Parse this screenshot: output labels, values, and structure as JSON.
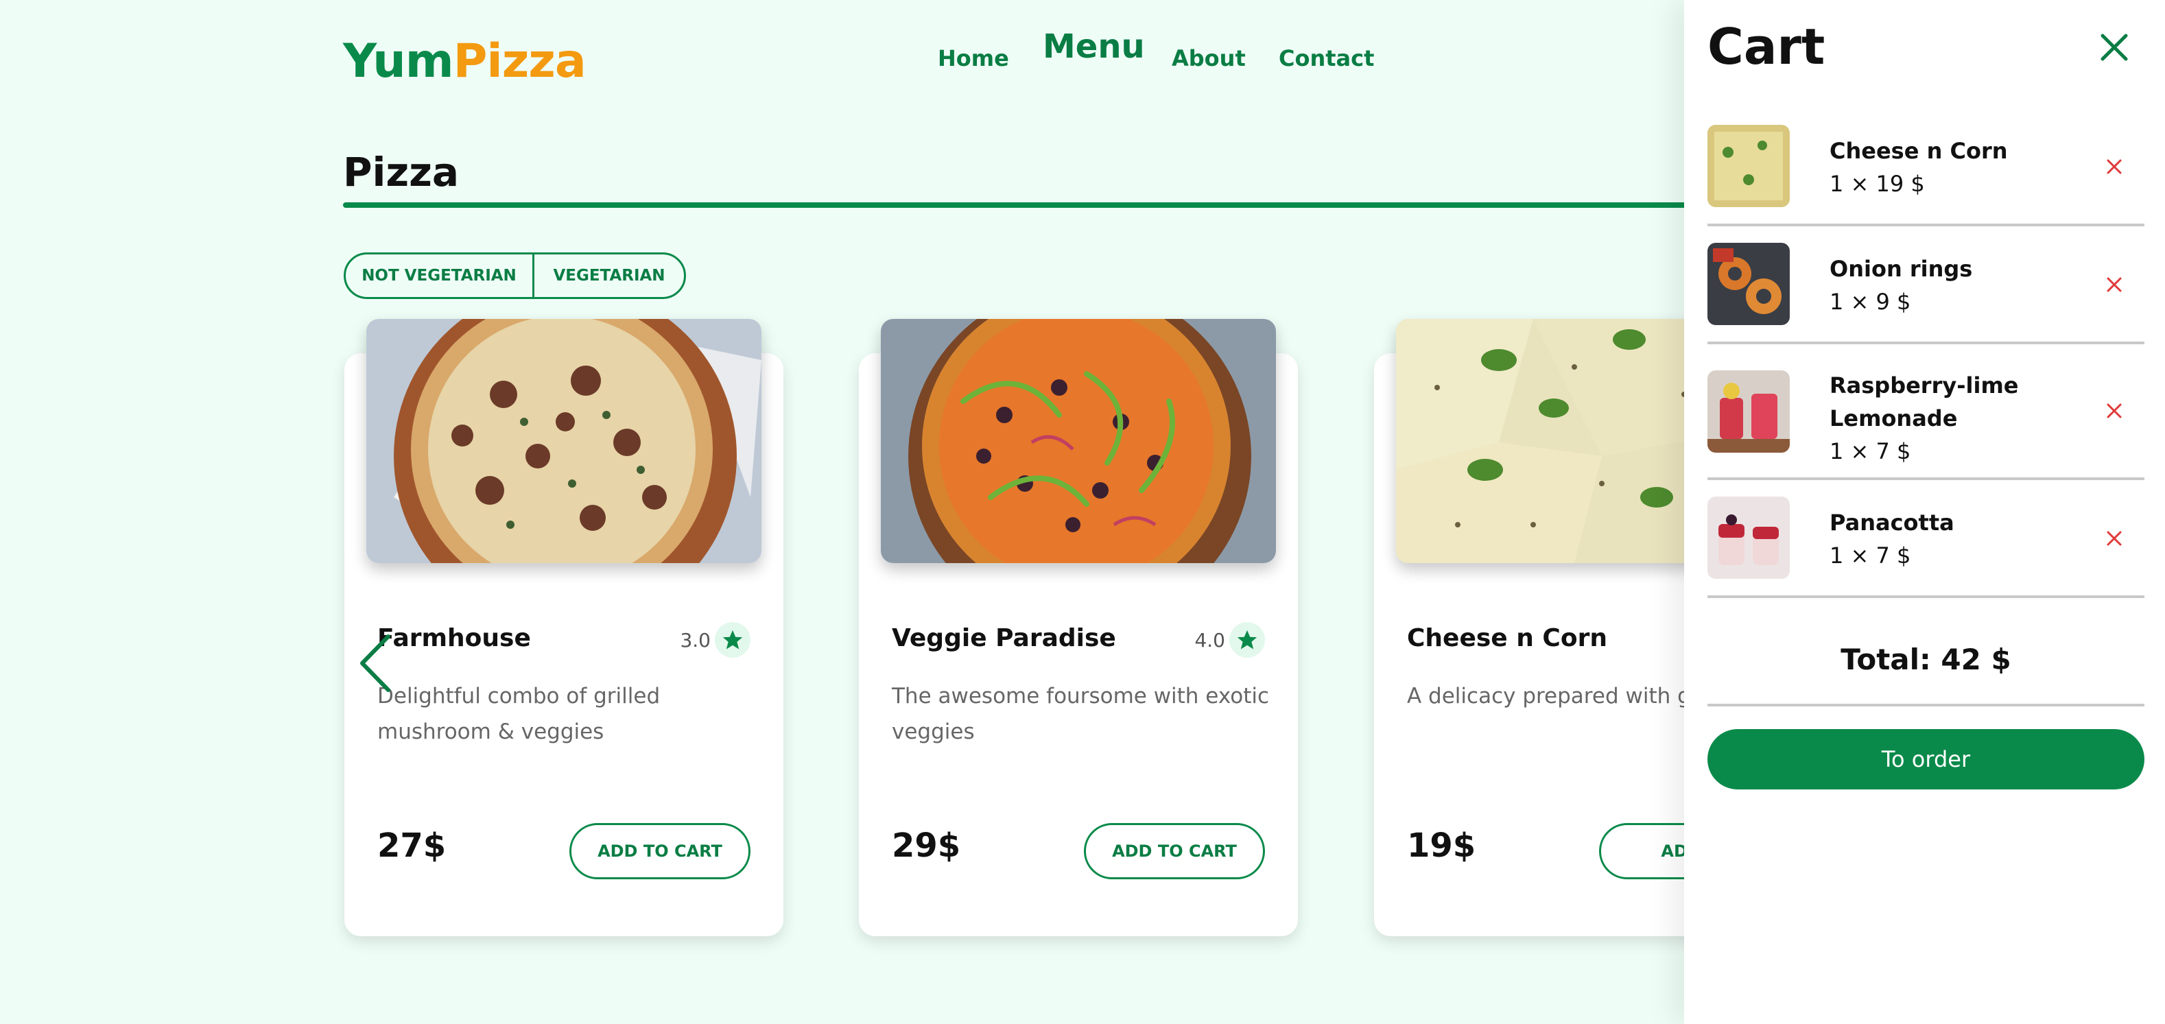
{
  "brand": {
    "logo_part1": "Yum",
    "logo_part2": "Pizza",
    "color_primary": "#0a8a4a",
    "color_accent": "#f39a11"
  },
  "nav": {
    "home": "Home",
    "menu": "Menu",
    "about": "About",
    "contact": "Contact"
  },
  "section": {
    "title": "Pizza"
  },
  "filters": {
    "not_veg": "NOT VEGETARIAN",
    "veg": "VEGETARIAN"
  },
  "products": [
    {
      "name": "Farmhouse",
      "rating": "3.0",
      "description": "Delightful combo of grilled mushroom & veggies",
      "price": "27$",
      "button": "ADD TO CART"
    },
    {
      "name": "Veggie Paradise",
      "rating": "4.0",
      "description": "The awesome foursome with exotic veggies",
      "price": "29$",
      "button": "ADD TO CART"
    },
    {
      "name": "Cheese n Corn",
      "rating": "",
      "description": "A delicacy prepared with gol",
      "price": "19$",
      "button": "ADD T"
    }
  ],
  "icons": {
    "prev": "chevron-left-icon",
    "star": "star-icon",
    "close": "close-icon",
    "remove": "remove-icon"
  },
  "cart": {
    "title": "Cart",
    "items": [
      {
        "name": "Cheese n Corn",
        "qty": "1 × 19 $"
      },
      {
        "name": "Onion rings",
        "qty": "1 × 9 $"
      },
      {
        "name": "Raspberry-lime Lemonade",
        "qty": "1 × 7 $"
      },
      {
        "name": "Panacotta",
        "qty": "1 × 7 $"
      }
    ],
    "total": "Total: 42 $",
    "order_button": "To order"
  }
}
